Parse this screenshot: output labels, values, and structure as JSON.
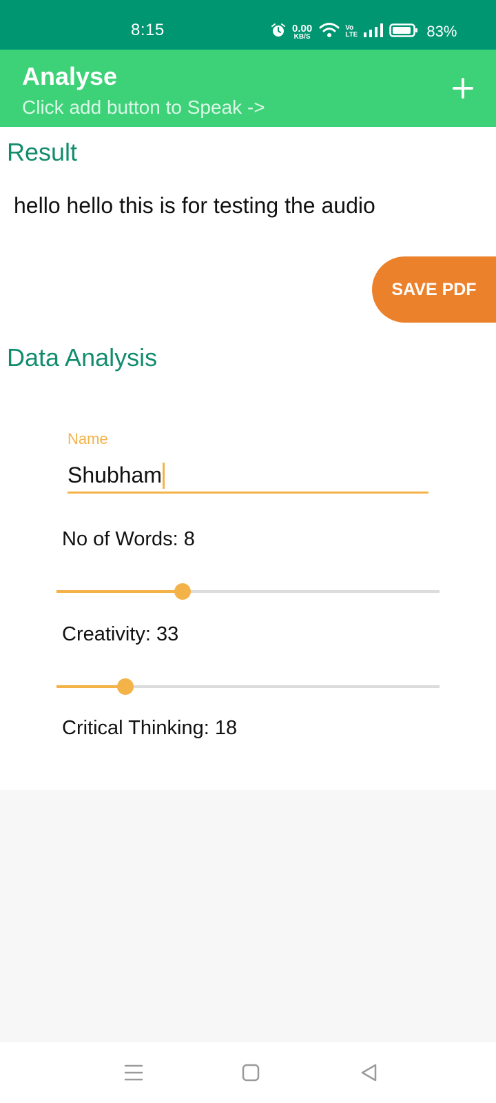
{
  "status_bar": {
    "time": "8:15",
    "net_speed_value": "0.00",
    "net_speed_unit": "KB/S",
    "volte_top": "Vo",
    "volte_bottom": "LTE",
    "battery_percent": "83%",
    "icons": [
      "alarm-icon",
      "wifi-icon",
      "volte-icon",
      "signal-icon",
      "battery-icon"
    ]
  },
  "app_bar": {
    "title": "Analyse",
    "subtitle": "Click add button to Speak ->",
    "add_icon": "plus-icon"
  },
  "result": {
    "title": "Result",
    "text": "hello hello this is for testing the audio",
    "save_pdf_label": "SAVE PDF"
  },
  "analysis": {
    "title": "Data Analysis",
    "name_label": "Name",
    "name_value": "Shubham",
    "words_label": "No of Words: 8",
    "words_slider_fraction": 0.33,
    "creativity_label": "Creativity: 33",
    "creativity_slider_fraction": 0.18,
    "critical_thinking_label": "Critical Thinking: 18"
  },
  "nav_bar": {
    "icons": [
      "menu-icon",
      "home-icon",
      "back-icon"
    ]
  },
  "colors": {
    "status_bar": "#009672",
    "app_bar": "#3dd178",
    "accent_teal": "#138c6e",
    "save_button": "#ec812c",
    "slider_accent": "#f4b349"
  }
}
